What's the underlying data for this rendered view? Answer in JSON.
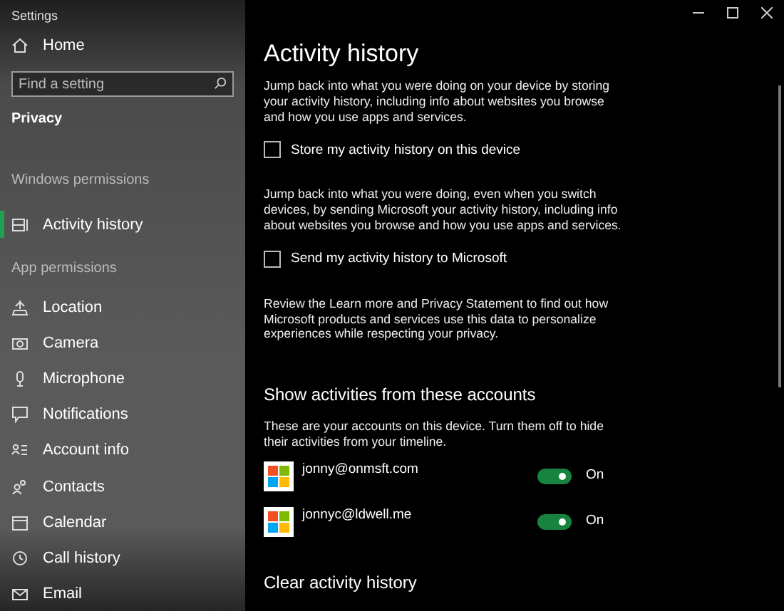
{
  "window": {
    "title": "Settings"
  },
  "sidebar": {
    "home": "Home",
    "search": {
      "placeholder": "Find a setting"
    },
    "category": "Privacy",
    "sections": [
      {
        "heading": "Windows permissions",
        "items": [
          {
            "label": "Activity history",
            "selected": true
          }
        ]
      },
      {
        "heading": "App permissions",
        "items": [
          {
            "label": "Location",
            "selected": false
          },
          {
            "label": "Camera",
            "selected": false
          },
          {
            "label": "Microphone",
            "selected": false
          },
          {
            "label": "Notifications",
            "selected": false
          },
          {
            "label": "Account info",
            "selected": false
          },
          {
            "label": "Contacts",
            "selected": false
          },
          {
            "label": "Calendar",
            "selected": false
          },
          {
            "label": "Call history",
            "selected": false
          },
          {
            "label": "Email",
            "selected": false
          }
        ]
      }
    ]
  },
  "content": {
    "title": "Activity history",
    "items": [
      {
        "kind": "paragraph",
        "text": "Jump back into what you were doing on your device by storing your activity history, including info about websites you browse and how you use apps and services."
      },
      {
        "kind": "checkbox",
        "label": "Store my activity history on this device",
        "checked": false
      },
      {
        "kind": "paragraph",
        "text": "Jump back into what you were doing, even when you switch devices, by sending Microsoft your activity history, including info about websites you browse and how you use apps and services."
      },
      {
        "kind": "checkbox",
        "label": "Send my activity history to Microsoft",
        "checked": false
      },
      {
        "kind": "paragraph",
        "text": "Review the Learn more and Privacy Statement to find out how Microsoft products and services use this data to personalize experiences while respecting your privacy."
      }
    ],
    "accounts_section": {
      "heading": "Show activities from these accounts",
      "description": "These are your accounts on this device. Turn them off to hide their activities from your timeline.",
      "accounts": [
        {
          "email": "jonny@onmsft.com",
          "on": true,
          "state_label": "On"
        },
        {
          "email": "jonnyc@ldwell.me",
          "on": true,
          "state_label": "On"
        }
      ]
    },
    "clear_section": {
      "heading": "Clear activity history"
    }
  }
}
